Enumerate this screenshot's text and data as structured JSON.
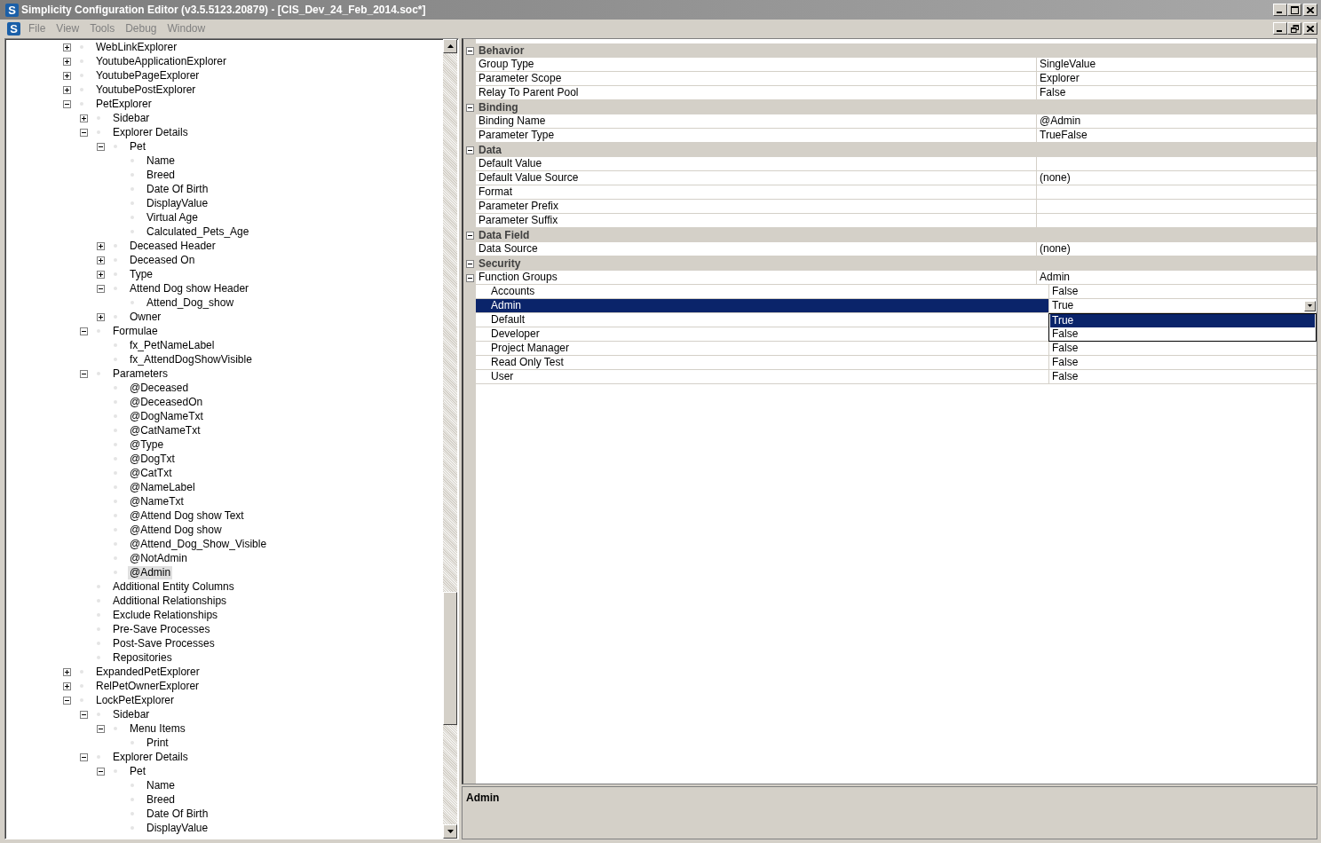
{
  "window": {
    "logo": "S",
    "title": "Simplicity Configuration Editor (v3.5.5123.20879) - [CIS_Dev_24_Feb_2014.soc*]"
  },
  "menu": {
    "logo": "S",
    "items": [
      "File",
      "View",
      "Tools",
      "Debug",
      "Window"
    ]
  },
  "tree": {
    "items": [
      {
        "label": "WebLinkExplorer",
        "expanded": false,
        "selected": false
      },
      {
        "label": "YoutubeApplicationExplorer",
        "expanded": false,
        "selected": false
      },
      {
        "label": "YoutubePageExplorer",
        "expanded": false,
        "selected": false
      },
      {
        "label": "YoutubePostExplorer",
        "expanded": false,
        "selected": false
      },
      {
        "label": "PetExplorer",
        "expanded": true,
        "selected": false,
        "children": [
          {
            "label": "Sidebar",
            "expanded": false,
            "selected": false
          },
          {
            "label": "Explorer Details",
            "expanded": true,
            "selected": false,
            "children": [
              {
                "label": "Pet",
                "expanded": true,
                "selected": false,
                "children": [
                  {
                    "label": "Name",
                    "selected": false
                  },
                  {
                    "label": "Breed",
                    "selected": false
                  },
                  {
                    "label": "Date Of Birth",
                    "selected": false
                  },
                  {
                    "label": "DisplayValue",
                    "selected": false
                  },
                  {
                    "label": "Virtual Age",
                    "selected": false
                  },
                  {
                    "label": "Calculated_Pets_Age",
                    "selected": false
                  }
                ]
              },
              {
                "label": "Deceased Header",
                "expanded": false,
                "selected": false
              },
              {
                "label": "Deceased On",
                "expanded": false,
                "selected": false
              },
              {
                "label": "Type",
                "expanded": false,
                "selected": false
              },
              {
                "label": "Attend Dog show Header",
                "expanded": true,
                "selected": false,
                "children": [
                  {
                    "label": "Attend_Dog_show",
                    "selected": false
                  }
                ]
              },
              {
                "label": "Owner",
                "expanded": false,
                "selected": false
              }
            ]
          },
          {
            "label": "Formulae",
            "expanded": true,
            "selected": false,
            "children": [
              {
                "label": "fx_PetNameLabel",
                "selected": false
              },
              {
                "label": "fx_AttendDogShowVisible",
                "selected": false
              }
            ]
          },
          {
            "label": "Parameters",
            "expanded": true,
            "selected": false,
            "children": [
              {
                "label": "@Deceased",
                "selected": false
              },
              {
                "label": "@DeceasedOn",
                "selected": false
              },
              {
                "label": "@DogNameTxt",
                "selected": false
              },
              {
                "label": "@CatNameTxt",
                "selected": false
              },
              {
                "label": "@Type",
                "selected": false
              },
              {
                "label": "@DogTxt",
                "selected": false
              },
              {
                "label": "@CatTxt",
                "selected": false
              },
              {
                "label": "@NameLabel",
                "selected": false
              },
              {
                "label": "@NameTxt",
                "selected": false
              },
              {
                "label": "@Attend Dog show Text",
                "selected": false
              },
              {
                "label": "@Attend Dog show",
                "selected": false
              },
              {
                "label": "@Attend_Dog_Show_Visible",
                "selected": false
              },
              {
                "label": "@NotAdmin",
                "selected": false
              },
              {
                "label": "@Admin",
                "selected": true
              }
            ]
          },
          {
            "label": "Additional Entity Columns",
            "selected": false
          },
          {
            "label": "Additional Relationships",
            "selected": false
          },
          {
            "label": "Exclude Relationships",
            "selected": false
          },
          {
            "label": "Pre-Save Processes",
            "selected": false
          },
          {
            "label": "Post-Save Processes",
            "selected": false
          },
          {
            "label": "Repositories",
            "selected": false
          }
        ]
      },
      {
        "label": "ExpandedPetExplorer",
        "expanded": false,
        "selected": false
      },
      {
        "label": "RelPetOwnerExplorer",
        "expanded": false,
        "selected": false
      },
      {
        "label": "LockPetExplorer",
        "expanded": true,
        "selected": false,
        "children": [
          {
            "label": "Sidebar",
            "expanded": true,
            "selected": false,
            "children": [
              {
                "label": "Menu Items",
                "expanded": true,
                "selected": false,
                "children": [
                  {
                    "label": "Print",
                    "selected": false
                  }
                ]
              }
            ]
          },
          {
            "label": "Explorer Details",
            "expanded": true,
            "selected": false,
            "children": [
              {
                "label": "Pet",
                "expanded": true,
                "selected": false,
                "children": [
                  {
                    "label": "Name",
                    "selected": false
                  },
                  {
                    "label": "Breed",
                    "selected": false
                  },
                  {
                    "label": "Date Of Birth",
                    "selected": false
                  },
                  {
                    "label": "DisplayValue",
                    "selected": false
                  }
                ]
              }
            ]
          }
        ]
      }
    ]
  },
  "properties": {
    "sections": [
      {
        "name": "Behavior",
        "expanded": true,
        "rows": [
          {
            "name": "Group Type",
            "value": "SingleValue",
            "selected": false
          },
          {
            "name": "Parameter Scope",
            "value": "Explorer",
            "selected": false
          },
          {
            "name": "Relay To Parent Pool",
            "value": "False",
            "selected": false
          }
        ]
      },
      {
        "name": "Binding",
        "expanded": true,
        "rows": [
          {
            "name": "Binding Name",
            "value": "@Admin",
            "selected": false
          },
          {
            "name": "Parameter Type",
            "value": "TrueFalse",
            "selected": false
          }
        ]
      },
      {
        "name": "Data",
        "expanded": true,
        "rows": [
          {
            "name": "Default Value",
            "selected": false
          },
          {
            "name": "Default Value Source",
            "value": "(none)",
            "selected": false
          },
          {
            "name": "Format",
            "selected": false
          },
          {
            "name": "Parameter Prefix",
            "selected": false
          },
          {
            "name": "Parameter Suffix",
            "selected": false
          }
        ]
      },
      {
        "name": "Data Field",
        "expanded": true,
        "rows": [
          {
            "name": "Data Source",
            "value": "(none)",
            "selected": false
          }
        ]
      },
      {
        "name": "Security",
        "expanded": true,
        "rows": [
          {
            "name": "Function Groups",
            "value": "Admin",
            "selected": false,
            "expanded": true,
            "children": [
              {
                "name": "Accounts",
                "value": "False",
                "selected": false
              },
              {
                "name": "Admin",
                "value": "True",
                "selected": true,
                "dropdown": [
                  {
                    "label": "True",
                    "selected": true
                  },
                  {
                    "label": "False",
                    "selected": false
                  }
                ]
              },
              {
                "name": "Default",
                "selected": false
              },
              {
                "name": "Developer",
                "selected": false
              },
              {
                "name": "Project Manager",
                "value": "False",
                "selected": false
              },
              {
                "name": "Read Only Test",
                "value": "False",
                "selected": false
              },
              {
                "name": "User",
                "value": "False",
                "selected": false
              }
            ]
          }
        ]
      }
    ]
  },
  "description": {
    "title": "Admin"
  }
}
